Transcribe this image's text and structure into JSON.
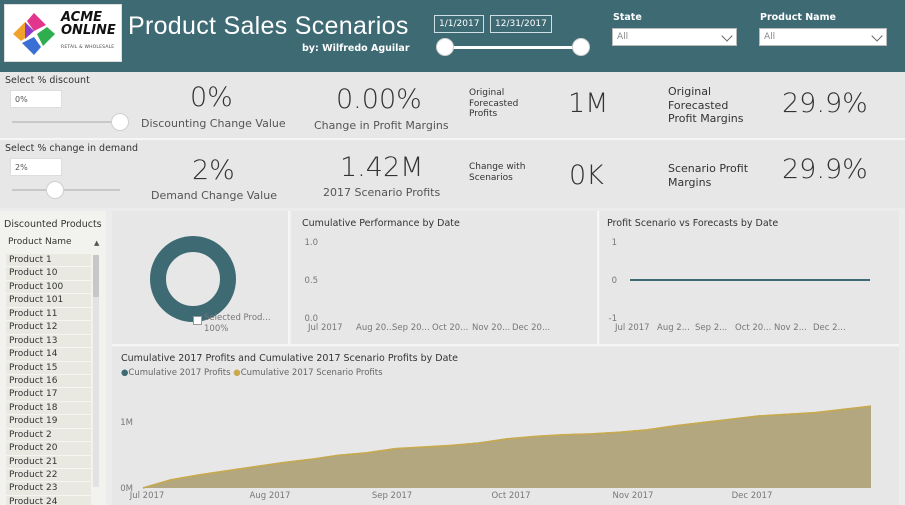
{
  "header": {
    "logo_line1": "ACME",
    "logo_line2": "ONLINE",
    "logo_sub": "RETAIL & WHOLESALE",
    "title": "Product Sales Scenarios",
    "byline": "by: Wilfredo Aguilar",
    "date_start": "1/1/2017",
    "date_end": "12/31/2017",
    "state_label": "State",
    "state_value": "All",
    "product_label": "Product Name",
    "product_value": "All"
  },
  "controls": {
    "discount_label": "Select % discount",
    "discount_value": "0%",
    "discount_slider_level": 1.0,
    "demand_label": "Select % change in demand",
    "demand_value": "2%",
    "demand_slider_level": 0.2
  },
  "kpis": {
    "discount_change_value": "0%",
    "discount_change_label": "Discounting Change Value",
    "profit_margin_change_value": "0.00%",
    "profit_margin_change_label": "Change in Profit Margins",
    "orig_forecast_profits_label": "Original Forecasted Profits",
    "orig_forecast_profits_value": "1M",
    "orig_forecast_margins_label": "Original Forecasted Profit Margins",
    "orig_forecast_margins_value": "29.9%",
    "demand_change_value": "2%",
    "demand_change_label": "Demand Change Value",
    "scenario_profits_value": "1.42M",
    "scenario_profits_label": "2017 Scenario Profits",
    "change_with_scenarios_label": "Change with Scenarios",
    "change_with_scenarios_value": "0K",
    "scenario_margins_label": "Scenario Profit Margins",
    "scenario_margins_value": "29.9%"
  },
  "products": {
    "title": "Discounted Products",
    "column_header": "Product Name",
    "sort_icon": "sort-ascending-icon",
    "items": [
      "Product 1",
      "Product 10",
      "Product 100",
      "Product 101",
      "Product 11",
      "Product 12",
      "Product 13",
      "Product 14",
      "Product 15",
      "Product 16",
      "Product 17",
      "Product 18",
      "Product 19",
      "Product 2",
      "Product 20",
      "Product 21",
      "Product 22",
      "Product 23",
      "Product 24"
    ]
  },
  "donut": {
    "legend_label": "Selected Prod...",
    "legend_pct": "100%",
    "color": "#3e6a74"
  },
  "colors": {
    "header_bg": "#3e6a74",
    "series1": "#3e6a74",
    "series2": "#c9aa4e",
    "area_fill": "#b2a77f"
  },
  "chart_data": [
    {
      "type": "line",
      "title": "Cumulative Performance by Date",
      "y_ticks": [
        "1.0",
        "0.5",
        "0.0"
      ],
      "x_ticks": [
        "Jul 2017",
        "Aug 20...",
        "Sep 20...",
        "Oct 20...",
        "Nov 20...",
        "Dec 20..."
      ],
      "series": []
    },
    {
      "type": "line",
      "title": "Profit Scenario vs Forecasts by Date",
      "y_ticks": [
        "1",
        "0",
        "-1"
      ],
      "x_ticks": [
        "Jul 2017",
        "Aug 2...",
        "Sep 2...",
        "Oct 20...",
        "Nov 2...",
        "Dec 2..."
      ],
      "ylim": [
        -1,
        1
      ],
      "series": [
        {
          "values": [
            0,
            0,
            0,
            0,
            0,
            0
          ]
        }
      ]
    },
    {
      "type": "area",
      "title": "Cumulative 2017 Profits and Cumulative 2017 Scenario Profits by Date",
      "legend": [
        "Cumulative 2017 Profits",
        "Cumulative 2017 Scenario Profits"
      ],
      "y_ticks": [
        "1M",
        "0M"
      ],
      "x_ticks": [
        "Jul 2017",
        "Aug 2017",
        "Sep 2017",
        "Oct 2017",
        "Nov 2017",
        "Dec 2017"
      ],
      "ylim": [
        0,
        1.4
      ],
      "x": [
        "Jul 1",
        "Jul 8",
        "Jul 15",
        "Jul 22",
        "Jul 29",
        "Aug 5",
        "Aug 12",
        "Aug 19",
        "Aug 26",
        "Sep 2",
        "Sep 9",
        "Sep 16",
        "Sep 23",
        "Sep 30",
        "Oct 7",
        "Oct 14",
        "Oct 21",
        "Oct 28",
        "Nov 4",
        "Nov 11",
        "Nov 18",
        "Nov 25",
        "Dec 2",
        "Dec 9",
        "Dec 16",
        "Dec 23",
        "Dec 31"
      ],
      "series": [
        {
          "name": "Cumulative 2017 Profits",
          "values": [
            0.0,
            0.1,
            0.16,
            0.21,
            0.26,
            0.31,
            0.35,
            0.4,
            0.43,
            0.48,
            0.5,
            0.52,
            0.55,
            0.6,
            0.63,
            0.65,
            0.66,
            0.68,
            0.71,
            0.76,
            0.8,
            0.84,
            0.88,
            0.9,
            0.92,
            0.96,
            1.0
          ]
        },
        {
          "name": "Cumulative 2017 Scenario Profits",
          "values": [
            0.0,
            0.1,
            0.16,
            0.21,
            0.26,
            0.31,
            0.35,
            0.4,
            0.43,
            0.48,
            0.5,
            0.52,
            0.55,
            0.6,
            0.63,
            0.65,
            0.66,
            0.68,
            0.71,
            0.76,
            0.8,
            0.84,
            0.88,
            0.9,
            0.92,
            0.96,
            1.0
          ]
        }
      ]
    }
  ]
}
